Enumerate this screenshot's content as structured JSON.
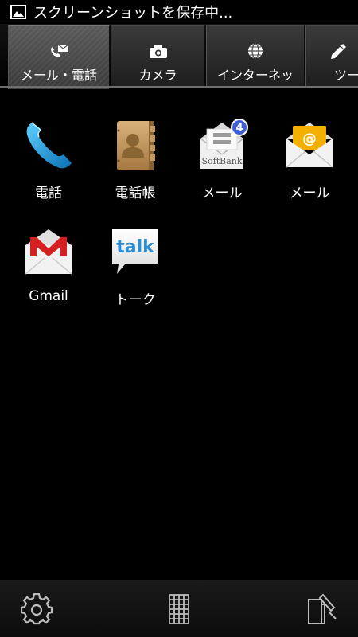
{
  "status_bar": {
    "icon": "picture-icon",
    "text": "スクリーンショットを保存中..."
  },
  "tabs": [
    {
      "label": "メール・電話",
      "icon": "phone-mail-icon",
      "active": true
    },
    {
      "label": "カメラ",
      "icon": "camera-icon",
      "active": false
    },
    {
      "label": "インターネッ",
      "icon": "globe-icon",
      "active": false
    },
    {
      "label": "ツー",
      "icon": "pen-icon",
      "active": false
    }
  ],
  "apps": [
    {
      "label": "電話",
      "icon": "phone-handset-icon"
    },
    {
      "label": "電話帳",
      "icon": "address-book-icon"
    },
    {
      "label": "メール",
      "icon": "softbank-mail-icon",
      "badge": "4",
      "icon_text": "SoftBank"
    },
    {
      "label": "メール",
      "icon": "email-envelope-icon",
      "icon_text": "@"
    },
    {
      "label": "Gmail",
      "icon": "gmail-icon"
    },
    {
      "label": "トーク",
      "icon": "talk-icon",
      "icon_text": "talk"
    }
  ],
  "bottom_bar": {
    "left": "gear-icon",
    "center": "app-grid-icon",
    "right": "edit-clipboard-icon"
  },
  "colors": {
    "background": "#000000",
    "tab_active": "#4a4a4a",
    "badge": "#3f5fd8",
    "phone_blue": "#1e9fe0",
    "gmail_red": "#d42020",
    "email_yellow": "#f4b000",
    "talk_blue": "#2c8fd6"
  }
}
